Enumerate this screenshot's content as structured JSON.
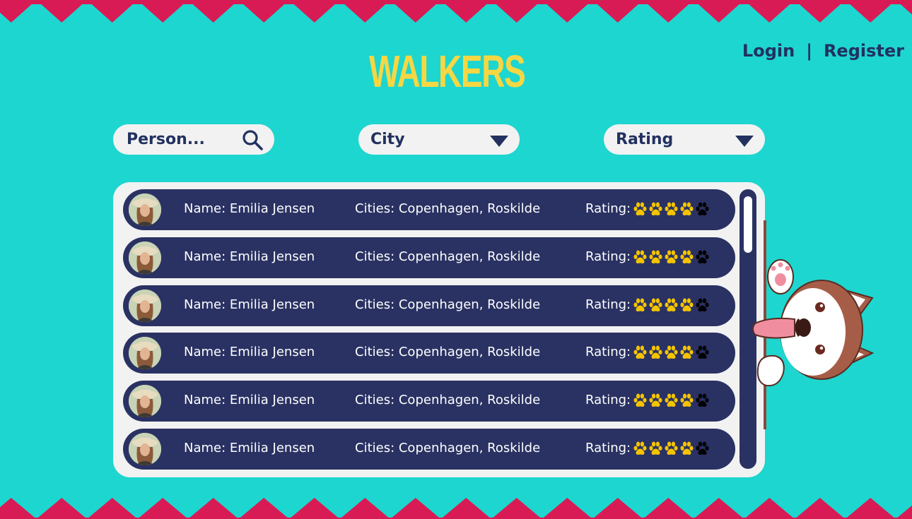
{
  "brand": {
    "logo_text": "WALKERS",
    "logo_color": "#f6d743"
  },
  "auth": {
    "login": "Login",
    "separator": "|",
    "register": "Register"
  },
  "filters": {
    "search": {
      "placeholder": "Person...",
      "icon": "search-icon"
    },
    "city": {
      "selected": "City",
      "icon": "chevron-down-icon"
    },
    "rating": {
      "selected": "Rating",
      "icon": "chevron-down-icon"
    }
  },
  "walkers": [
    {
      "name": "Name: Emilia Jensen",
      "cities": "Cities: Copenhagen, Roskilde",
      "rating_label": "Rating:",
      "rating": 4,
      "max_rating": 5
    },
    {
      "name": "Name: Emilia Jensen",
      "cities": "Cities: Copenhagen, Roskilde",
      "rating_label": "Rating:",
      "rating": 4,
      "max_rating": 5
    },
    {
      "name": "Name: Emilia Jensen",
      "cities": "Cities: Copenhagen, Roskilde",
      "rating_label": "Rating:",
      "rating": 4,
      "max_rating": 5
    },
    {
      "name": "Name: Emilia Jensen",
      "cities": "Cities: Copenhagen, Roskilde",
      "rating_label": "Rating:",
      "rating": 4,
      "max_rating": 5
    },
    {
      "name": "Name: Emilia Jensen",
      "cities": "Cities: Copenhagen, Roskilde",
      "rating_label": "Rating:",
      "rating": 4,
      "max_rating": 5
    },
    {
      "name": "Name: Emilia Jensen",
      "cities": "Cities: Copenhagen, Roskilde",
      "rating_label": "Rating:",
      "rating": 4,
      "max_rating": 5
    }
  ],
  "colors": {
    "background": "#1dd6cf",
    "zigzag": "#d81b55",
    "row": "#2a3263",
    "paw_filled": "#f5c400",
    "paw_empty": "#000000",
    "text_dark": "#223160"
  }
}
